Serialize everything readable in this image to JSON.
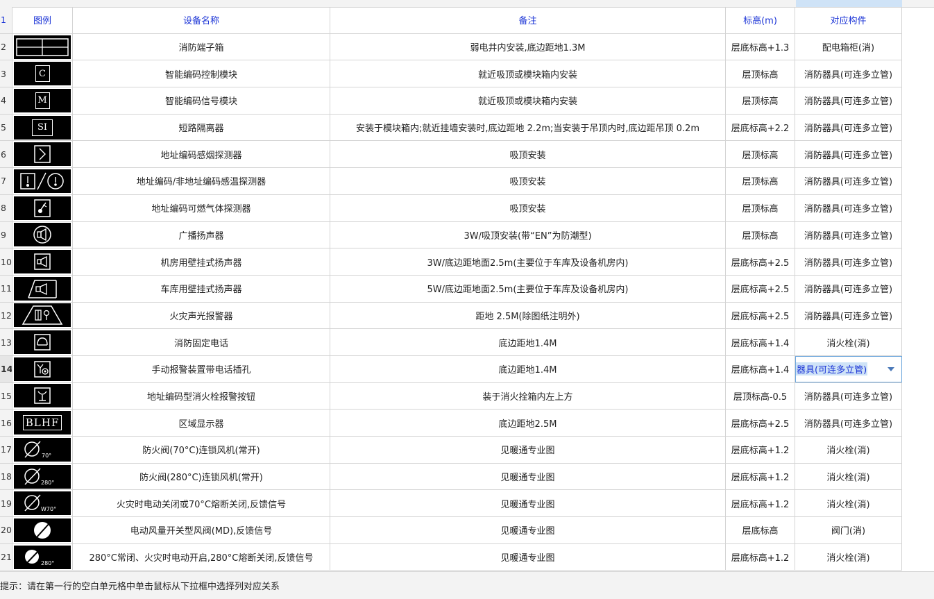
{
  "header": {
    "row_number": "1",
    "col_icon": "图例",
    "col_name": "设备名称",
    "col_note": "备注",
    "col_elev": "标高(m)",
    "col_map": "对应构件"
  },
  "rows": [
    {
      "num": "2",
      "name": "消防端子箱",
      "note": "弱电井内安装,底边距地1.3M",
      "elev": "层底标高+1.3",
      "map": "配电箱柜(消)"
    },
    {
      "num": "3",
      "name": "智能编码控制模块",
      "note": "就近吸顶或模块箱内安装",
      "elev": "层顶标高",
      "map": "消防器具(可连多立管)"
    },
    {
      "num": "4",
      "name": "智能编码信号模块",
      "note": "就近吸顶或模块箱内安装",
      "elev": "层顶标高",
      "map": "消防器具(可连多立管)"
    },
    {
      "num": "5",
      "name": "短路隔离器",
      "note": "安装于模块箱内;就近挂墙安装时,底边距地 2.2m;当安装于吊顶内时,底边距吊顶 0.2m",
      "elev": "层底标高+2.2",
      "map": "消防器具(可连多立管)"
    },
    {
      "num": "6",
      "name": "地址编码感烟探测器",
      "note": "吸顶安装",
      "elev": "层顶标高",
      "map": "消防器具(可连多立管)"
    },
    {
      "num": "7",
      "name": "地址编码/非地址编码感温探测器",
      "note": "吸顶安装",
      "elev": "层顶标高",
      "map": "消防器具(可连多立管)"
    },
    {
      "num": "8",
      "name": "地址编码可燃气体探测器",
      "note": "吸顶安装",
      "elev": "层顶标高",
      "map": "消防器具(可连多立管)"
    },
    {
      "num": "9",
      "name": "广播扬声器",
      "note": "3W/吸顶安装(带“EN”为防潮型)",
      "elev": "层顶标高",
      "map": "消防器具(可连多立管)"
    },
    {
      "num": "10",
      "name": "机房用壁挂式扬声器",
      "note": "3W/底边距地面2.5m(主要位于车库及设备机房内)",
      "elev": "层底标高+2.5",
      "map": "消防器具(可连多立管)"
    },
    {
      "num": "11",
      "name": "车库用壁挂式扬声器",
      "note": "5W/底边距地面2.5m(主要位于车库及设备机房内)",
      "elev": "层底标高+2.5",
      "map": "消防器具(可连多立管)"
    },
    {
      "num": "12",
      "name": "火灾声光报警器",
      "note": "距地 2.5M(除图纸注明外)",
      "elev": "层底标高+2.5",
      "map": "消防器具(可连多立管)"
    },
    {
      "num": "13",
      "name": "消防固定电话",
      "note": "底边距地1.4M",
      "elev": "层底标高+1.4",
      "map": "消火栓(消)"
    },
    {
      "num": "14",
      "name": "手动报警装置带电话插孔",
      "note": "底边距地1.4M",
      "elev": "层底标高+1.4",
      "map": "器具(可连多立管)"
    },
    {
      "num": "15",
      "name": "地址编码型消火栓报警按钮",
      "note": "装于消火拴箱内左上方",
      "elev": "层顶标高-0.5",
      "map": "消防器具(可连多立管)"
    },
    {
      "num": "16",
      "name": "区域显示器",
      "note": "底边距地2.5M",
      "elev": "层底标高+2.5",
      "map": "消防器具(可连多立管)"
    },
    {
      "num": "17",
      "name": "防火阀(70°C)连锁风机(常开)",
      "note": "见暖通专业图",
      "elev": "层底标高+1.2",
      "map": "消火栓(消)"
    },
    {
      "num": "18",
      "name": "防火阀(280°C)连锁风机(常开)",
      "note": "见暖通专业图",
      "elev": "层底标高+1.2",
      "map": "消火栓(消)"
    },
    {
      "num": "19",
      "name": "火灾时电动关闭或70°C熔断关闭,反馈信号",
      "note": "见暖通专业图",
      "elev": "层底标高+1.2",
      "map": "消火栓(消)"
    },
    {
      "num": "20",
      "name": "电动风量开关型风阀(MD),反馈信号",
      "note": "见暖通专业图",
      "elev": "层底标高",
      "map": "阀门(消)"
    },
    {
      "num": "21",
      "name": "280°C常闭、火灾时电动开启,280°C熔断关闭,反馈信号",
      "note": "见暖通专业图",
      "elev": "层底标高+1.2",
      "map": "消火栓(消)"
    }
  ],
  "symbols": {
    "r3": "C",
    "r4": "M",
    "r5": "SI",
    "r16": "BLHF",
    "r17": "70°",
    "r18": "280°",
    "r19": "W70°",
    "r21": "280°"
  },
  "status_bar": "提示：请在第一行的空白单元格中单击鼠标从下拉框中选择列对应关系",
  "colors": {
    "header_text": "#1a33d6",
    "selection": "#cfe3f7",
    "dropdown_border": "#6ea7dd",
    "symbol_bg": "#000000"
  }
}
